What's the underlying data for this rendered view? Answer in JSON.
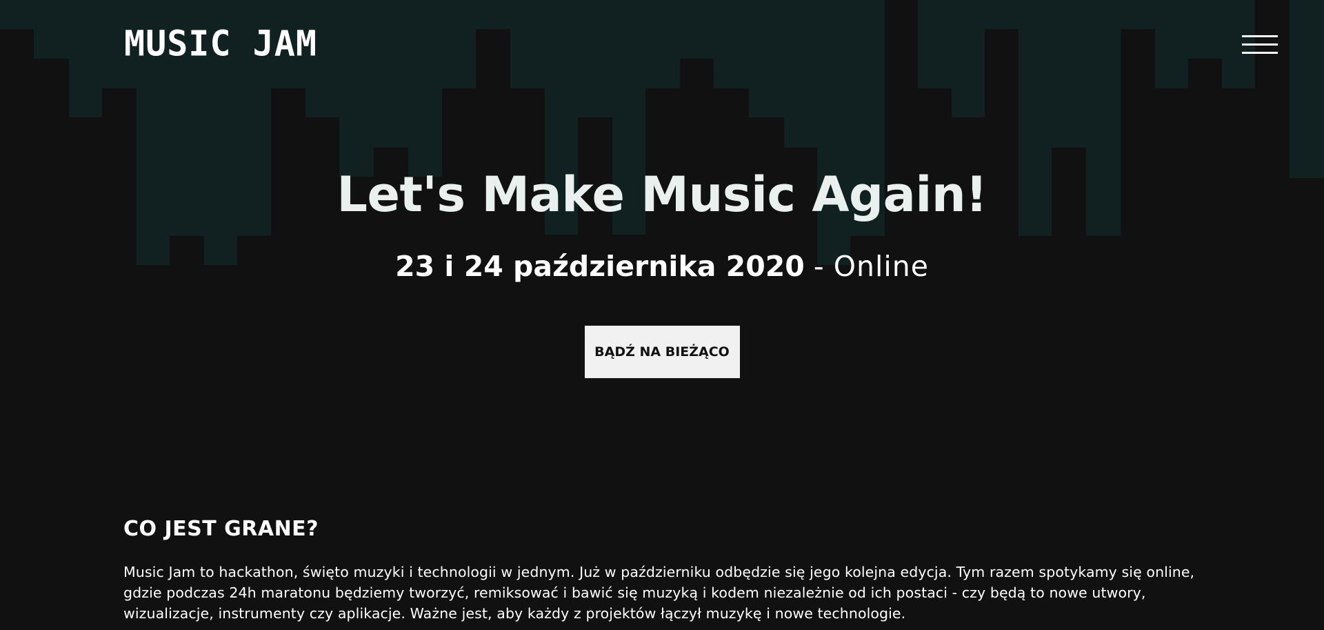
{
  "header": {
    "logo_text": "MUSIC JAM",
    "menu_icon": "hamburger-menu-icon"
  },
  "hero": {
    "title": "Let's Make Music Again!",
    "date_text": "23 i 24 października 2020",
    "separator": "-",
    "location": "Online",
    "cta_label": "BĄDŹ NA BIEŻĄCO"
  },
  "about": {
    "heading": "CO JEST GRANE?",
    "paragraph": "Music Jam to hackathon, święto muzyki i technologii w jednym. Już w październiku odbędzie się jego kolejna edycja. Tym razem spotykamy się online, gdzie podczas 24h maratonu będziemy tworzyć, remiksować i bawić się muzyką i kodem niezależnie od ich postaci - czy będą to nowe utwory, wizualizacje, instrumenty czy aplikacje. Ważne jest, aby każdy z projektów łączył muzykę i nowe technologie."
  },
  "colors": {
    "background": "#111111",
    "skyline_teal": "#112020",
    "button_bg": "#f1f1f1",
    "title_text": "#eaf0ee"
  }
}
